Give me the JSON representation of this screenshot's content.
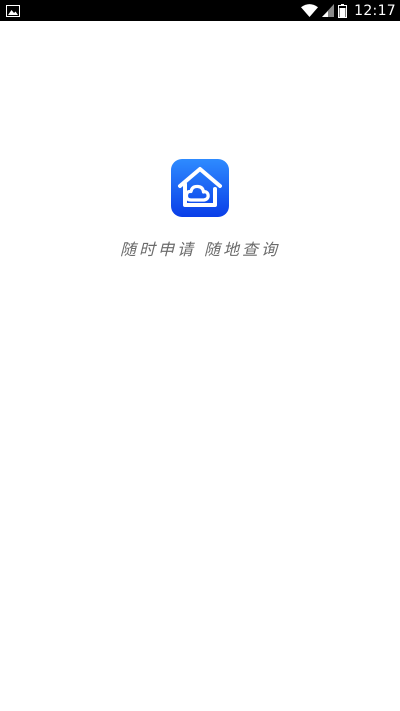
{
  "status_bar": {
    "time": "12:17",
    "icons": [
      "image-notification-icon",
      "wifi-icon",
      "signal-icon",
      "battery-icon"
    ]
  },
  "splash": {
    "logo_icon": "house-cloud-logo-icon",
    "tagline": "随时申请 随地查询",
    "colors": {
      "logo_gradient_top": "#2e8bff",
      "logo_gradient_bottom": "#0a3ee8",
      "tagline": "#6b6b6b"
    }
  }
}
